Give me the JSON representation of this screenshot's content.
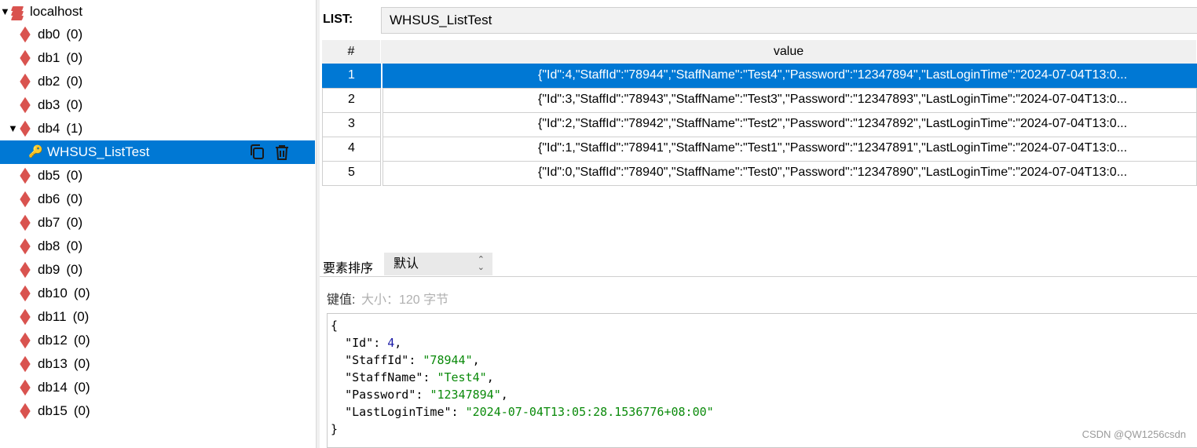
{
  "tree": {
    "server": {
      "label": "localhost"
    },
    "dbs": [
      {
        "name": "db0",
        "count": "(0)"
      },
      {
        "name": "db1",
        "count": "(0)"
      },
      {
        "name": "db2",
        "count": "(0)"
      },
      {
        "name": "db3",
        "count": "(0)"
      },
      {
        "name": "db4",
        "count": "(1)"
      },
      {
        "name": "db5",
        "count": "(0)"
      },
      {
        "name": "db6",
        "count": "(0)"
      },
      {
        "name": "db7",
        "count": "(0)"
      },
      {
        "name": "db8",
        "count": "(0)"
      },
      {
        "name": "db9",
        "count": "(0)"
      },
      {
        "name": "db10",
        "count": "(0)"
      },
      {
        "name": "db11",
        "count": "(0)"
      },
      {
        "name": "db12",
        "count": "(0)"
      },
      {
        "name": "db13",
        "count": "(0)"
      },
      {
        "name": "db14",
        "count": "(0)"
      },
      {
        "name": "db15",
        "count": "(0)"
      }
    ],
    "selected_key": "WHSUS_ListTest"
  },
  "list": {
    "label": "LIST:",
    "name": "WHSUS_ListTest",
    "columns": [
      "#",
      "value"
    ],
    "rows": [
      {
        "idx": "1",
        "value": "{\"Id\":4,\"StaffId\":\"78944\",\"StaffName\":\"Test4\",\"Password\":\"12347894\",\"LastLoginTime\":\"2024-07-04T13:0..."
      },
      {
        "idx": "2",
        "value": "{\"Id\":3,\"StaffId\":\"78943\",\"StaffName\":\"Test3\",\"Password\":\"12347893\",\"LastLoginTime\":\"2024-07-04T13:0..."
      },
      {
        "idx": "3",
        "value": "{\"Id\":2,\"StaffId\":\"78942\",\"StaffName\":\"Test2\",\"Password\":\"12347892\",\"LastLoginTime\":\"2024-07-04T13:0..."
      },
      {
        "idx": "4",
        "value": "{\"Id\":1,\"StaffId\":\"78941\",\"StaffName\":\"Test1\",\"Password\":\"12347891\",\"LastLoginTime\":\"2024-07-04T13:0..."
      },
      {
        "idx": "5",
        "value": "{\"Id\":0,\"StaffId\":\"78940\",\"StaffName\":\"Test0\",\"Password\":\"12347890\",\"LastLoginTime\":\"2024-07-04T13:0..."
      }
    ]
  },
  "sort": {
    "label": "要素排序",
    "value": "默认"
  },
  "keyvalue": {
    "label": "键值:",
    "size": "大小：120 字节"
  },
  "editor": {
    "open": "{",
    "close": "}",
    "fields": [
      {
        "key": "\"Id\"",
        "value": "4",
        "type": "number",
        "comma": ","
      },
      {
        "key": "\"StaffId\"",
        "value": "\"78944\"",
        "type": "string",
        "comma": ","
      },
      {
        "key": "\"StaffName\"",
        "value": "\"Test4\"",
        "type": "string",
        "comma": ","
      },
      {
        "key": "\"Password\"",
        "value": "\"12347894\"",
        "type": "string",
        "comma": ","
      },
      {
        "key": "\"LastLoginTime\"",
        "value": "\"2024-07-04T13:05:28.1536776+08:00\"",
        "type": "string",
        "comma": ""
      }
    ]
  },
  "watermark": "CSDN @QW1256csdn",
  "icons": {
    "server": "redis-stack-icon",
    "db": "redis-db-icon",
    "key": "key-icon",
    "copy": "copy-icon",
    "delete": "trash-icon",
    "sort": "chevron-updown-icon"
  },
  "colors": {
    "selection": "#0078d4",
    "redis": "#d9534f",
    "json_string": "#0a8a0a",
    "json_number": "#1a1aa6"
  }
}
